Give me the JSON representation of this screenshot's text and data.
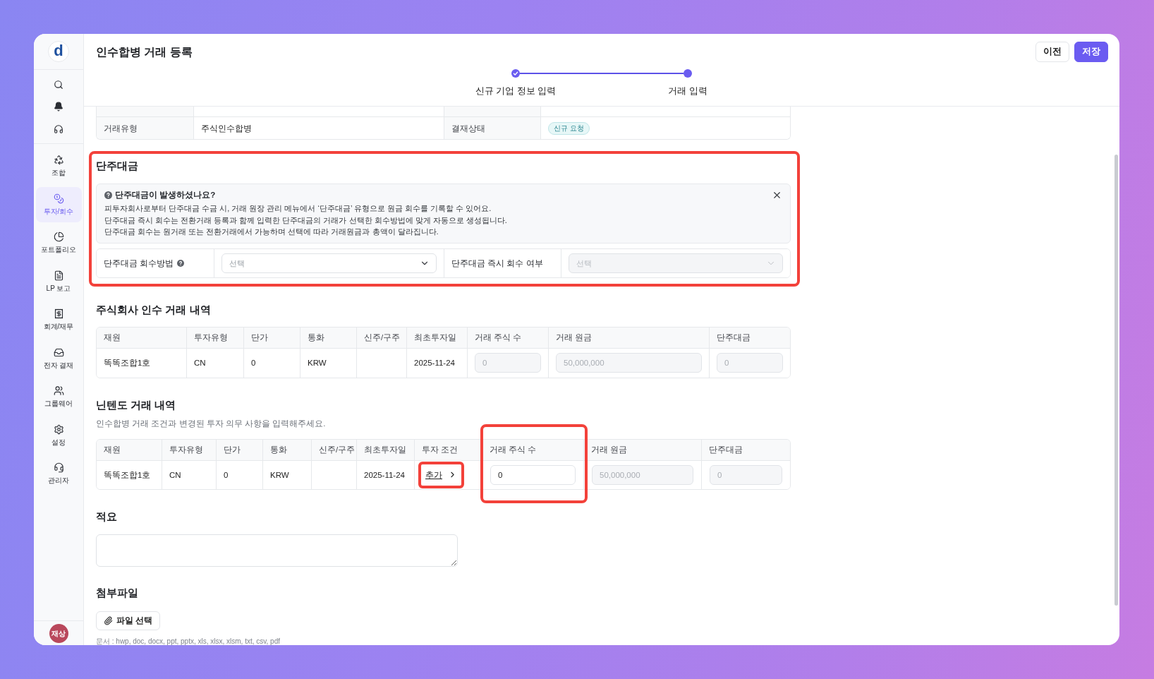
{
  "app": {
    "logo": "d",
    "avatar": "재상"
  },
  "sidebar": {
    "items": [
      {
        "label": "조합",
        "selected": false
      },
      {
        "label": "투자/회수",
        "selected": true
      },
      {
        "label": "포트폴리오",
        "selected": false
      },
      {
        "label": "LP 보고",
        "selected": false
      },
      {
        "label": "회계/재무",
        "selected": false
      },
      {
        "label": "전자 결재",
        "selected": false
      },
      {
        "label": "그룹웨어",
        "selected": false
      },
      {
        "label": "설정",
        "selected": false
      },
      {
        "label": "관리자",
        "selected": false
      }
    ]
  },
  "header": {
    "title": "인수합병 거래 등록",
    "buttons": [
      {
        "label": "이전",
        "kind": "secondary"
      },
      {
        "label": "저장",
        "kind": "primary"
      }
    ]
  },
  "stepper": [
    {
      "label": "신규 기업 정보 입력",
      "completed": true
    },
    {
      "label": "거래 입력",
      "completed": false
    }
  ],
  "deal_info": {
    "rows": [
      {
        "cells": [
          {
            "kind": "label",
            "text": "거래유형"
          },
          {
            "kind": "value",
            "text": "주식인수합병"
          },
          {
            "kind": "label",
            "text": "결재상태"
          },
          {
            "kind": "badge",
            "text": "신규 요청"
          }
        ]
      }
    ]
  },
  "fractional_payment": {
    "title": "단주대금",
    "highlighted": true,
    "notice": {
      "title": "단주대금이 발생하셨나요?",
      "lines": [
        "피투자회사로부터 단주대금 수금 시, 거래 원장 관리 메뉴에서 ‘단주대금’ 유형으로 원금 회수를 기록할 수 있어요.",
        "단주대금 즉시 회수는 전환거래 등록과 함께 입력한 단주대금의 거래가 선택한 회수방법에 맞게 자동으로 생성됩니다.",
        "단주대금 회수는 원거래 또는 전환거래에서 가능하며 선택에 따라 거래원금과 총액이 달라집니다."
      ]
    },
    "fields": [
      {
        "label": "단주대금 회수방법",
        "help": true,
        "placeholder": "선택",
        "disabled": false
      },
      {
        "label": "단주대금 즉시 회수 여부",
        "help": false,
        "placeholder": "선택",
        "disabled": true
      }
    ]
  },
  "acquisition_table": {
    "title": "주식회사 인수 거래 내역",
    "columns": [
      {
        "label": "재원",
        "highlighted": false
      },
      {
        "label": "투자유형",
        "highlighted": false
      },
      {
        "label": "단가",
        "highlighted": false
      },
      {
        "label": "통화",
        "highlighted": false
      },
      {
        "label": "신주/구주",
        "highlighted": false
      },
      {
        "label": "최초투자일",
        "highlighted": false
      },
      {
        "label": "거래 주식 수",
        "highlighted": false
      },
      {
        "label": "거래 원금",
        "highlighted": false
      },
      {
        "label": "단주대금",
        "highlighted": false
      }
    ],
    "rows": [
      {
        "cells": [
          {
            "kind": "text",
            "text": "똑똑조합1호"
          },
          {
            "kind": "text",
            "text": "CN"
          },
          {
            "kind": "text",
            "text": "0"
          },
          {
            "kind": "text",
            "text": "KRW"
          },
          {
            "kind": "empty"
          },
          {
            "kind": "text",
            "text": "2025-11-24"
          },
          {
            "kind": "input",
            "value": "0",
            "disabled": true
          },
          {
            "kind": "input",
            "value": "50,000,000",
            "disabled": true
          },
          {
            "kind": "input",
            "value": "0",
            "disabled": true
          }
        ]
      }
    ]
  },
  "nintendo_table": {
    "title": "닌텐도 거래 내역",
    "subtitle": "인수합병 거래 조건과 변경된 투자 의무 사항을 입력해주세요.",
    "columns": [
      {
        "label": "재원",
        "highlighted": false
      },
      {
        "label": "투자유형",
        "highlighted": false
      },
      {
        "label": "단가",
        "highlighted": false
      },
      {
        "label": "통화",
        "highlighted": false
      },
      {
        "label": "신주/구주",
        "highlighted": false
      },
      {
        "label": "최초투자일",
        "highlighted": false
      },
      {
        "label": "투자 조건",
        "highlighted": false
      },
      {
        "label": "거래 주식 수",
        "highlighted": true
      },
      {
        "label": "거래 원금",
        "highlighted": false
      },
      {
        "label": "단주대금",
        "highlighted": false
      }
    ],
    "rows": [
      {
        "cells": [
          {
            "kind": "text",
            "text": "똑똑조합1호"
          },
          {
            "kind": "text",
            "text": "CN"
          },
          {
            "kind": "text",
            "text": "0"
          },
          {
            "kind": "text",
            "text": "KRW"
          },
          {
            "kind": "empty"
          },
          {
            "kind": "text",
            "text": "2025-11-24"
          },
          {
            "kind": "link",
            "text": "추가",
            "highlighted": true
          },
          {
            "kind": "input",
            "value": "0",
            "disabled": false
          },
          {
            "kind": "input",
            "value": "50,000,000",
            "disabled": true
          },
          {
            "kind": "input",
            "value": "0",
            "disabled": true
          }
        ]
      }
    ]
  },
  "memo": {
    "title": "적요"
  },
  "attachments": {
    "title": "첨부파일",
    "button": "파일 선택",
    "hint": "문서 : hwp, doc, docx, ppt, pptx, xls, xlsx, xlsm, txt, csv, pdf"
  }
}
